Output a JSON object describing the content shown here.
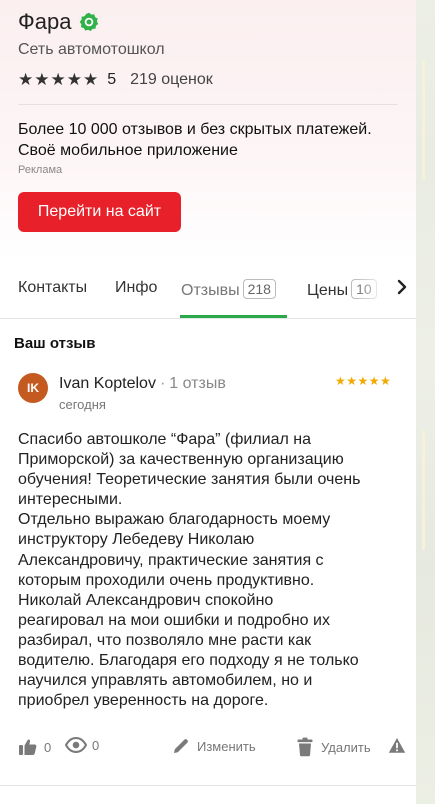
{
  "business": {
    "name": "Фара",
    "category": "Сеть автомотошкол",
    "stars": "★★★★★",
    "rating": "5",
    "reviews_count": "219 оценок"
  },
  "ad": {
    "text": "Более 10 000 отзывов и без скрытых платежей. Своё мобильное приложение",
    "label": "Реклама",
    "cta_label": "Перейти на сайт"
  },
  "tabs": [
    {
      "label": "Контакты"
    },
    {
      "label": "Инфо"
    },
    {
      "label": "Отзывы",
      "count": "218",
      "active": true
    },
    {
      "label": "Цены",
      "count": "10"
    }
  ],
  "reviews_section": {
    "title": "Ваш отзыв"
  },
  "review": {
    "avatar_initials": "IK",
    "author": "Ivan Koptelov",
    "author_meta": "1 отзыв",
    "date": "сегодня",
    "stars": "★★★★★",
    "text_lines": [
      "Спасибо автошколе “Фара” (филиал на",
      "Приморской) за качественную организацию",
      "обучения! Теоретические занятия были очень",
      "интересными.",
      "Отдельно выражаю благодарность моему",
      "инструктору Лебедеву Николаю",
      "Александровичу, практические занятия с",
      "которым проходили очень продуктивно.",
      "Николай Александрович спокойно",
      "реагировал на мои ошибки и подробно их",
      "разбирал, что позволяло мне расти как",
      "водителю. Благодаря его подходу я не только",
      "научился управлять автомобилем, но и",
      "приобрел уверенность на дороге."
    ],
    "likes": "0",
    "views": "0",
    "edit_label": "Изменить",
    "delete_label": "Удалить"
  },
  "colors": {
    "accent_red": "#e8202a",
    "accent_green": "#2ba84a",
    "star_gold": "#f2a900",
    "avatar": "#c45a1f"
  },
  "icons": [
    "verified-badge-icon",
    "chevron-right-icon",
    "thumbs-up-icon",
    "eye-icon",
    "pencil-icon",
    "trash-icon",
    "warning-icon"
  ]
}
